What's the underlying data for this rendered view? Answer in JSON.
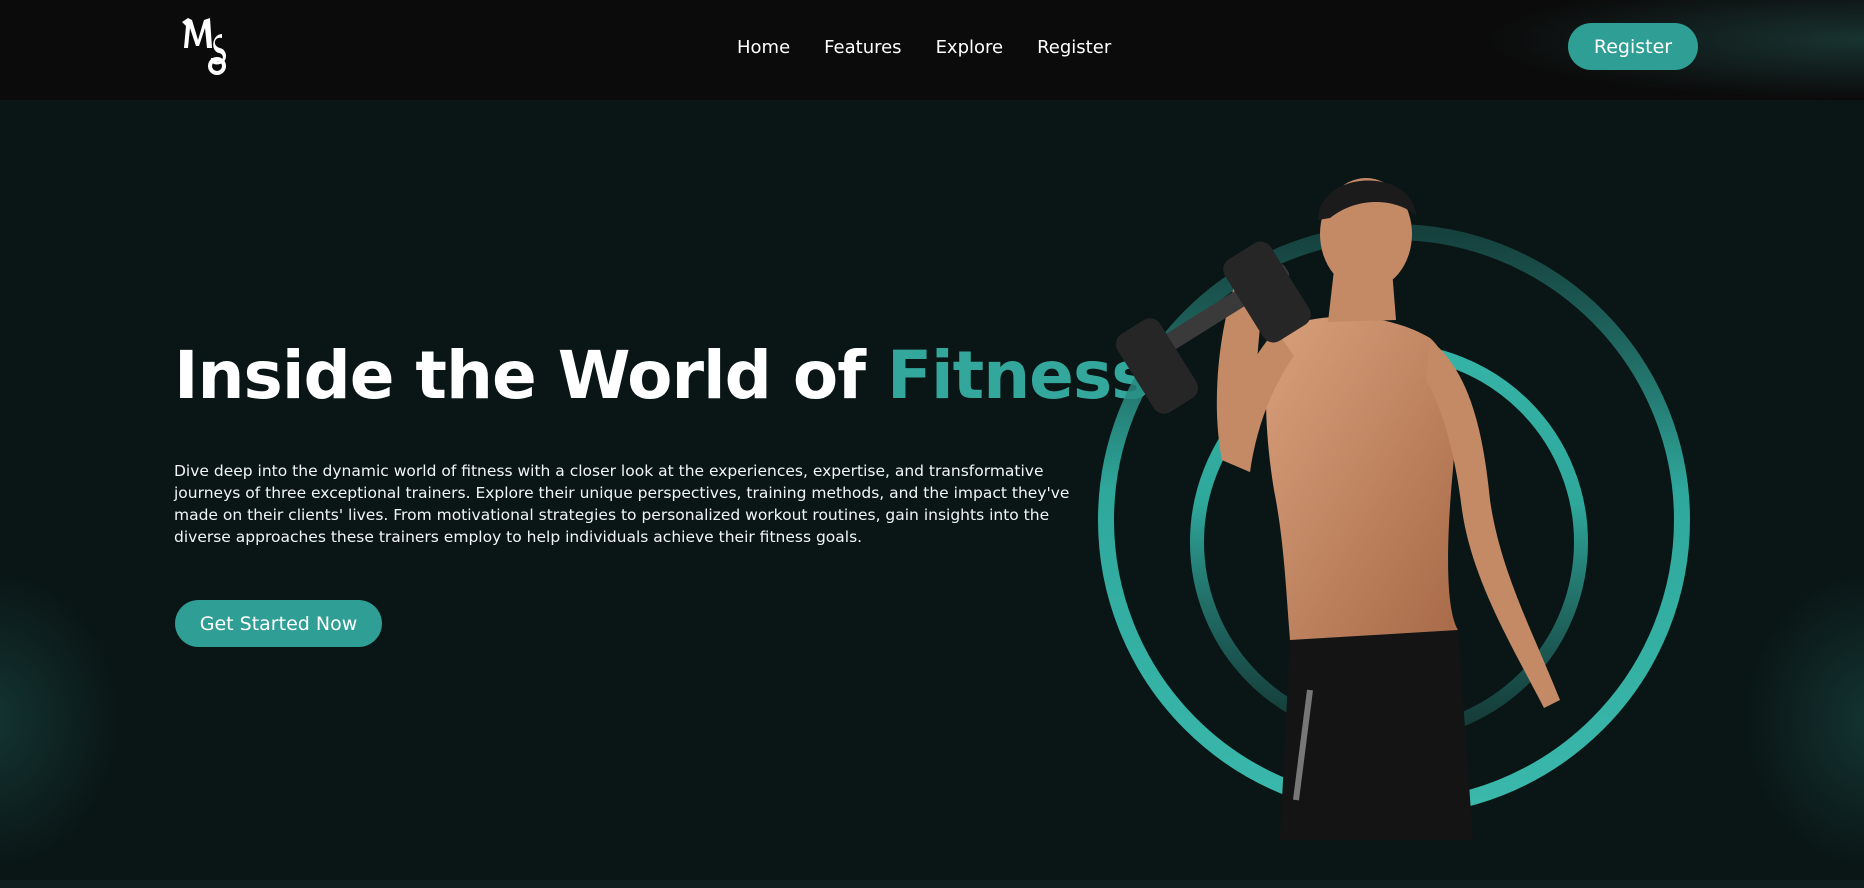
{
  "nav": {
    "logo_letters": "MS",
    "links": [
      "Home",
      "Features",
      "Explore",
      "Register"
    ],
    "register_button": "Register"
  },
  "hero": {
    "title_main": "Inside the World of",
    "title_accent": "Fitness.",
    "description": "Dive deep into the dynamic world of fitness with a closer look at the experiences, expertise, and transformative journeys of three exceptional trainers. Explore their unique perspectives, training methods, and the impact they've made on their clients' lives. From motivational strategies to personalized workout routines, gain insights into the diverse approaches these trainers employ to help individuals achieve their fitness goals.",
    "cta_button": "Get Started Now"
  },
  "colors": {
    "accent": "#33a79c",
    "button": "#2f9e95",
    "navbar_bg": "#0b0b0b",
    "hero_bg": "#0a1616"
  },
  "icons": {
    "logo": "ms-monogram-logo",
    "hero_image": "trainer-with-dumbbell-illustration"
  }
}
